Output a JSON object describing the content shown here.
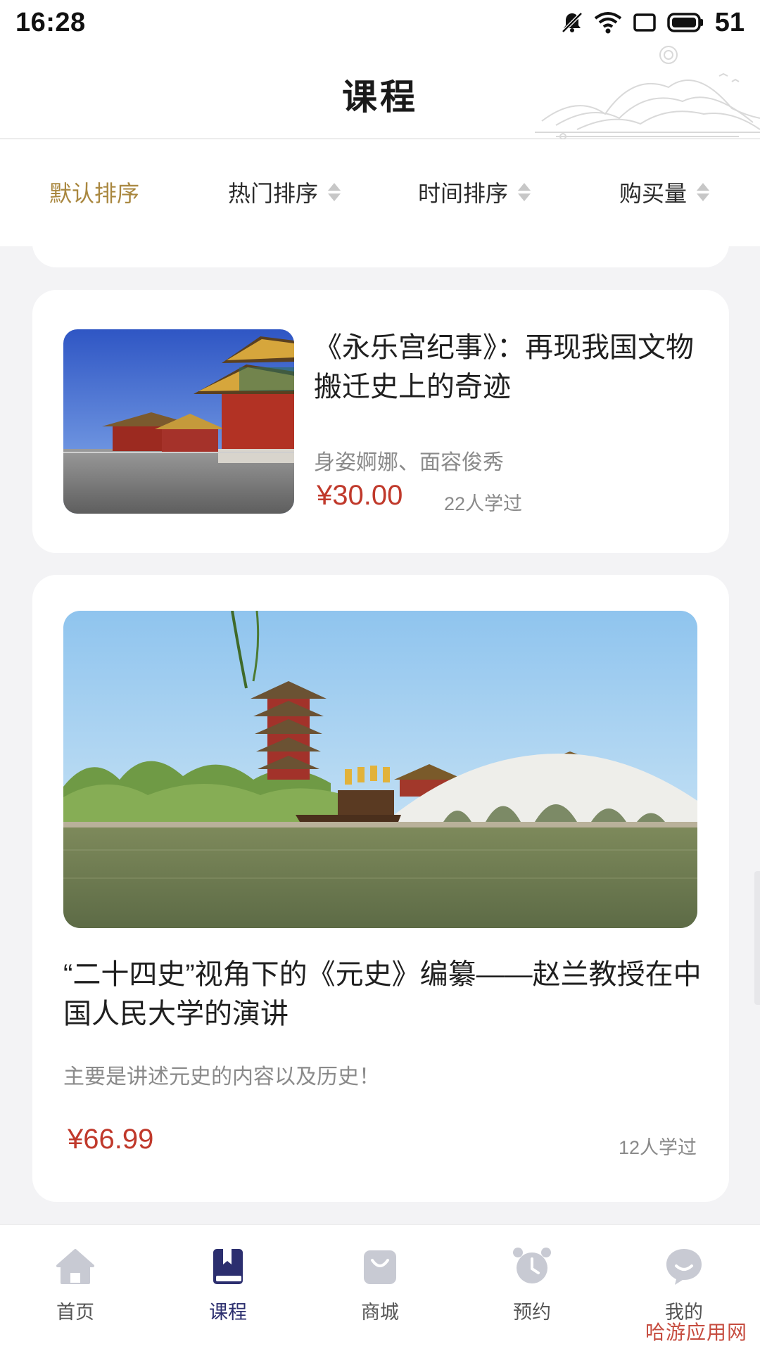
{
  "status_bar": {
    "time": "16:28",
    "battery_level": "51",
    "icons": [
      "mute-icon",
      "wifi-icon",
      "screen-rotate-icon",
      "battery-icon"
    ]
  },
  "header": {
    "title": "课程"
  },
  "sort_bar": {
    "items": [
      {
        "label": "默认排序",
        "active": true
      },
      {
        "label": "热门排序",
        "active": false
      },
      {
        "label": "时间排序",
        "active": false
      },
      {
        "label": "购买量",
        "active": false
      }
    ]
  },
  "courses": [
    {
      "title": "《永乐宫纪事》：再现我国文物搬迁史上的奇迹",
      "subtitle": "身姿婀娜、面容俊秀",
      "price": "¥30.00",
      "learners": "22人学过",
      "image": "palace-photo"
    },
    {
      "title": "“二十四史”视角下的《元史》编纂——赵兰教授在中国人民大学的演讲",
      "subtitle": "主要是讲述元史的内容以及历史！",
      "price": "¥66.99",
      "learners": "12人学过",
      "image": "lake-bridge-photo"
    }
  ],
  "tab_bar": {
    "items": [
      {
        "label": "首页",
        "icon": "home-icon",
        "active": false
      },
      {
        "label": "课程",
        "icon": "book-icon",
        "active": true
      },
      {
        "label": "商城",
        "icon": "shopping-bag-icon",
        "active": false
      },
      {
        "label": "预约",
        "icon": "alarm-clock-icon",
        "active": false
      },
      {
        "label": "我的",
        "icon": "chat-bubble-icon",
        "active": false
      }
    ]
  },
  "watermark": "哈游应用网",
  "colors": {
    "accent_active_sort": "#a9873f",
    "price": "#c0392b",
    "tab_active": "#2c2f6f",
    "tab_inactive": "#c8cad3"
  }
}
